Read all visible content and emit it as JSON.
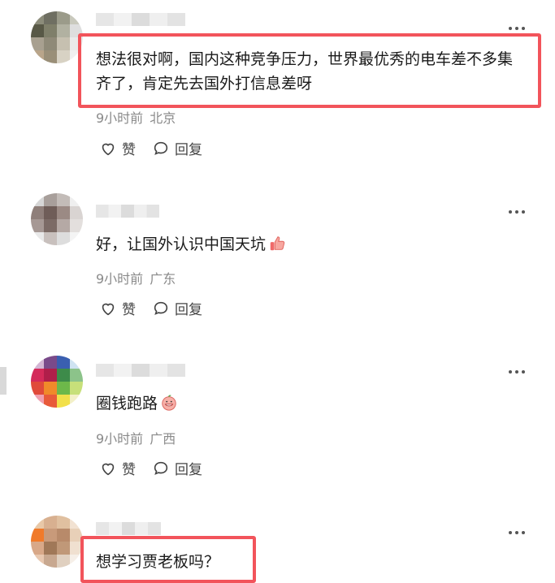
{
  "comments": [
    {
      "text": "想法很对啊，国内这种竞争压力，世界最优秀的电车差不多集齐了，肯定先去国外打信息差呀",
      "time": "9小时前",
      "location": "北京",
      "like_label": "赞",
      "reply_label": "回复"
    },
    {
      "text": "好，让国外认识中国天坑",
      "emoji": "thumbs-up-emoji",
      "time": "9小时前",
      "location": "广东",
      "like_label": "赞",
      "reply_label": "回复"
    },
    {
      "text": "圈钱跑路",
      "emoji": "grinning-peach-emoji",
      "time": "9小时前",
      "location": "广西",
      "like_label": "赞",
      "reply_label": "回复"
    },
    {
      "text": "想学习贾老板吗？"
    }
  ],
  "colors": {
    "highlight": "#f2545b",
    "meta": "#8a8a8a"
  }
}
